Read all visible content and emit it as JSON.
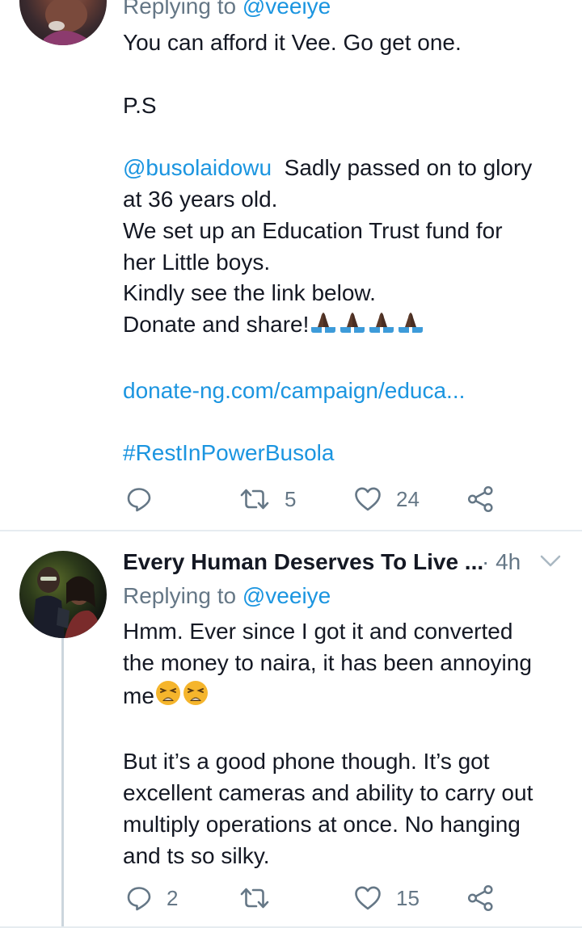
{
  "tweet1": {
    "replying_prefix": "Replying to",
    "replying_handle": "@veeiye",
    "line1": "You can afford it Vee. Go get one.",
    "ps": "P.S",
    "mention": "@busolaidowu",
    "mention_rest": "  Sadly passed on to glory",
    "line_age": "at 36 years old.",
    "line_trust1": "We set up an Education Trust fund for",
    "line_trust2": "her Little boys.",
    "line_link": "Kindly see the link below.",
    "line_donate": "Donate and share!",
    "url": "donate-ng.com/campaign/educa...",
    "hashtag": "#RestInPowerBusola",
    "retweets": "5",
    "likes": "24"
  },
  "tweet2": {
    "display_name": "Every Human Deserves To Live ...",
    "time": "· 4h",
    "replying_prefix": "Replying to",
    "replying_handle": "@veeiye",
    "p1_line1": "Hmm. Ever since I got it and converted",
    "p1_line2": "the money to naira, it has been annoying",
    "p1_line3": "me",
    "p2_line1": "But it’s a good phone though. It’s got",
    "p2_line2": "excellent cameras and ability to carry out",
    "p2_line3": "multiply operations at once. No hanging",
    "p2_line4": "and ts so silky.",
    "replies": "2",
    "likes": "15"
  },
  "icons": {
    "reply": "reply-icon",
    "retweet": "retweet-icon",
    "like": "heart-icon",
    "share": "share-icon",
    "caret": "chevron-down-icon",
    "praying": "praying-hands-emoji",
    "weary": "weary-face-emoji"
  },
  "colors": {
    "link": "#1b95e0",
    "muted": "#657786",
    "text": "#141823",
    "divider": "#e6ecf0"
  }
}
